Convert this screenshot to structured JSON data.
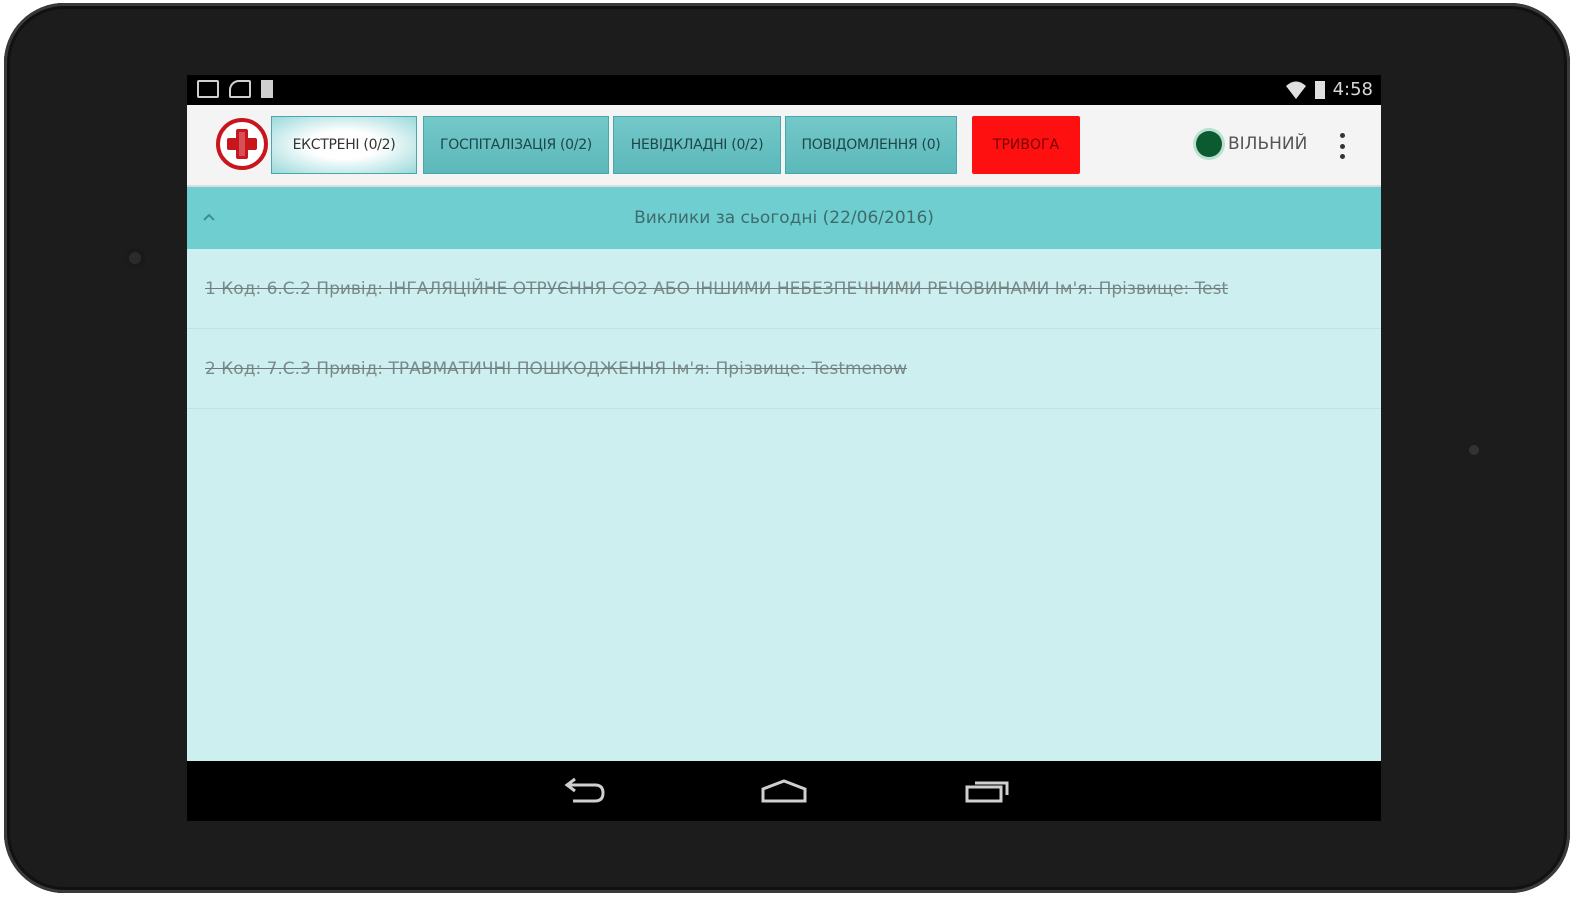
{
  "statusbar": {
    "time": "4:58",
    "icons": [
      "gallery-icon",
      "sync-icon",
      "sim-icon",
      "wifi-icon",
      "battery-icon"
    ]
  },
  "topbar": {
    "logo_icon": "medical-cross-icon",
    "tabs": [
      {
        "label": "ЕКСТРЕНІ (0/2)",
        "active": true
      },
      {
        "label": "ГОСПІТАЛІЗАЦІЯ (0/2)",
        "active": false
      },
      {
        "label": "НЕВІДКЛАДНІ (0/2)",
        "active": false
      },
      {
        "label": "ПОВІДОМЛЕННЯ (0)",
        "active": false
      }
    ],
    "alarm_label": "ТРИВОГА",
    "status_label": "ВІЛЬНИЙ",
    "menu_icon": "overflow-menu-icon"
  },
  "group": {
    "title": "Виклики за сьогодні (22/06/2016)",
    "expanded": true
  },
  "calls": [
    {
      "text": "1 Код: 6.C.2 Привід: ІНГАЛЯЦІЙНЕ ОТРУЄННЯ CO2 АБО ІНШИМИ НЕБЕЗПЕЧНИМИ РЕЧОВИНАМИ Ім'я:  Прізвище: Test"
    },
    {
      "text": "2 Код: 7.C.3 Привід: ТРАВМАТИЧНІ  ПОШКОДЖЕННЯ Ім'я:  Прізвище: Testmenow"
    }
  ],
  "navbar": {
    "buttons": [
      "back-icon",
      "home-icon",
      "recent-apps-icon"
    ]
  },
  "colors": {
    "accent": "#6fcfd0",
    "list_bg": "#cdeff0",
    "alarm": "#ff1010",
    "status_free": "#0c5a30",
    "logo_red": "#c8161d"
  }
}
